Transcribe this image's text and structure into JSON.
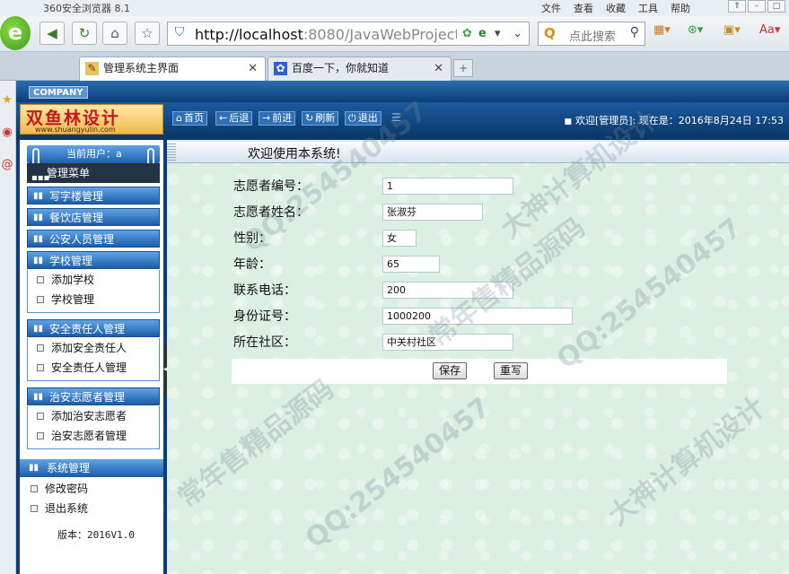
{
  "browser": {
    "title": "360安全浏览器 8.1",
    "menu": [
      "文件",
      "查看",
      "收藏",
      "工具",
      "帮助"
    ],
    "url_host": "http://localhost",
    "url_rest": ":8080/JavaWebProject/logir",
    "search_placeholder": "点此搜索",
    "tabs": [
      {
        "label": "管理系统主界面",
        "active": true
      },
      {
        "label": "百度一下，你就知道",
        "active": false
      }
    ]
  },
  "site": {
    "company": "COMPANY",
    "brand_name": "双鱼林设计",
    "brand_url": "www.shuangyulin.com",
    "nav": [
      {
        "icon": "⌂",
        "label": "首页"
      },
      {
        "icon": "←",
        "label": "后退"
      },
      {
        "icon": "→",
        "label": "前进"
      },
      {
        "icon": "↻",
        "label": "刷新"
      },
      {
        "icon": "⏻",
        "label": "退出"
      }
    ],
    "welcome": "欢迎[管理员]:   现在是：2016年8月24日  17:53"
  },
  "sidebar": {
    "user": "当前用户：a",
    "menu_title": "管理菜单",
    "sections": [
      {
        "title": "写字楼管理",
        "items": []
      },
      {
        "title": "餐饮店管理",
        "items": []
      },
      {
        "title": "公安人员管理",
        "items": []
      },
      {
        "title": "学校管理",
        "items": [
          "添加学校",
          "学校管理"
        ]
      },
      {
        "title": "安全责任人管理",
        "items": [
          "添加安全责任人",
          "安全责任人管理"
        ]
      },
      {
        "title": "治安志愿者管理",
        "items": [
          "添加治安志愿者",
          "治安志愿者管理"
        ]
      }
    ],
    "system": {
      "title": "系统管理",
      "items": [
        "修改密码",
        "退出系统"
      ]
    },
    "version": "版本：2016V1.0"
  },
  "main": {
    "title": "欢迎使用本系统!",
    "fields": [
      {
        "label": "志愿者编号：",
        "value": "1"
      },
      {
        "label": "志愿者姓名：",
        "value": "张淑芬"
      },
      {
        "label": "性别：",
        "value": "女"
      },
      {
        "label": "年龄：",
        "value": "65"
      },
      {
        "label": "联系电话：",
        "value": "200"
      },
      {
        "label": "身份证号：",
        "value": "1000200"
      },
      {
        "label": "所在社区：",
        "value": "中关村社区"
      }
    ],
    "save_label": "保存",
    "reset_label": "重写"
  },
  "watermarks": [
    "QQ:254540457",
    "常年售精品源码",
    "大神计算机设计"
  ]
}
